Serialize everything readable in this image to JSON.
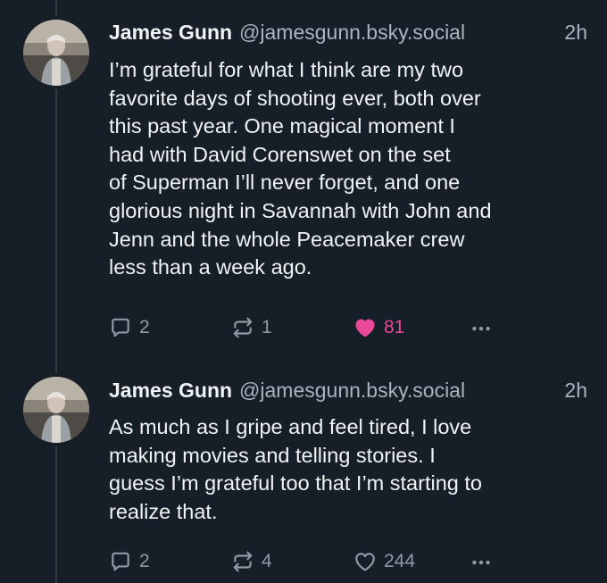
{
  "posts": [
    {
      "author": {
        "name": "James Gunn",
        "handle": "@jamesgunn.bsky.social",
        "avatar_icon": "avatar-photo"
      },
      "time": "2h",
      "text": "I’m grateful for what I think are my two\nfavorite days of shooting ever, both over\nthis past year. One magical moment I\nhad with David Corenswet on the set\nof Superman I’ll never forget, and one\nglorious night in Savannah with John and\nJenn and the whole Peacemaker crew\nless than a week ago.",
      "actions": {
        "replies": "2",
        "reposts": "1",
        "likes": "81",
        "liked": true,
        "more_icon": "more-dots-icon"
      }
    },
    {
      "author": {
        "name": "James Gunn",
        "handle": "@jamesgunn.bsky.social",
        "avatar_icon": "avatar-photo"
      },
      "time": "2h",
      "text": "As much as I gripe and feel tired, I love\nmaking movies and telling stories. I\nguess I’m grateful too that I’m starting to\nrealize that.",
      "actions": {
        "replies": "2",
        "reposts": "4",
        "likes": "244",
        "liked": false,
        "more_icon": "more-dots-icon"
      }
    }
  ],
  "colors": {
    "background": "#161e27",
    "text": "#f1f3f5",
    "muted": "#aab4c0",
    "icon": "#8f9aa6",
    "like": "#ec4899",
    "thread_line": "#2e3a47"
  }
}
